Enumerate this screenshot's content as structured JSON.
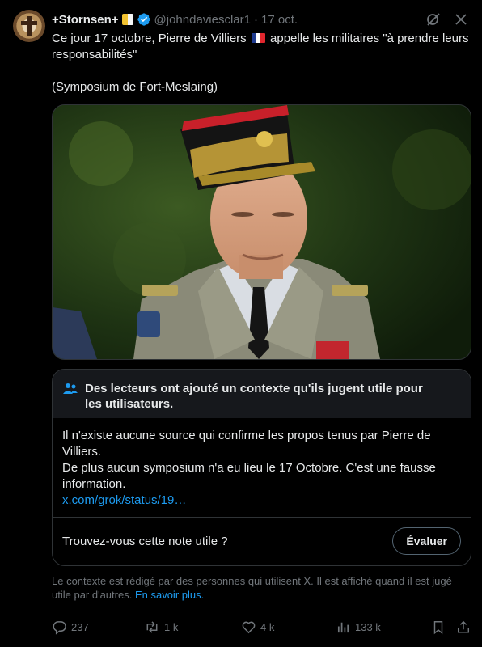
{
  "author": {
    "display_name": "+Stornsen+",
    "handle": "@johndaviesclar1",
    "separator": "·",
    "date": "17 oct.",
    "verified": true
  },
  "tweet": {
    "line1_before_flag": "Ce jour 17 octobre, Pierre de Villiers",
    "line1_after_flag": "appelle les militaires \"à prendre leurs responsabilités\"",
    "line2": "(Symposium de Fort-Meslaing)",
    "flag_colors": [
      "#1f3b8f",
      "#ffffff",
      "#e1262d"
    ]
  },
  "community_note": {
    "header": "Des lecteurs ont ajouté un contexte qu'ils jugent utile pour les utilisateurs.",
    "body_line1": "Il n'existe aucune source qui confirme les propos tenus par Pierre de Villiers.",
    "body_line2": "De plus aucun symposium n'a eu lieu le 17 Octobre. C'est une fausse information.",
    "link": "x.com/grok/status/19…",
    "question": "Trouvez-vous cette note utile ?",
    "rate_button": "Évaluer"
  },
  "disclaimer": {
    "text": "Le contexte est rédigé par des personnes qui utilisent X. Il est affiché quand il est jugé utile par d'autres.",
    "more": "En savoir plus."
  },
  "actions": {
    "replies": "237",
    "reposts": "1 k",
    "likes": "4 k",
    "views": "133 k"
  },
  "colors": {
    "background": "#000000",
    "text": "#e7e9ea",
    "muted": "#71767b",
    "accent": "#1d9bf0",
    "border": "#2f3336"
  }
}
